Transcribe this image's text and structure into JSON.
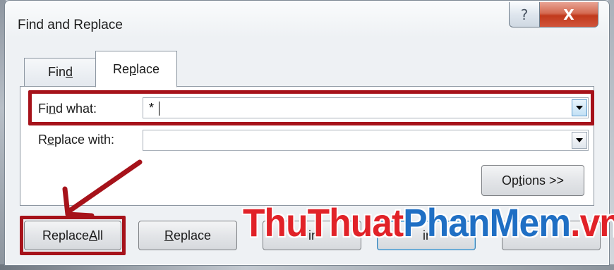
{
  "window": {
    "title": "Find and Replace",
    "help_glyph": "?",
    "close_glyph": "X"
  },
  "tabs": [
    {
      "label_pre": "Fin",
      "label_mnemonic": "d",
      "label_post": ""
    },
    {
      "label_pre": "Re",
      "label_mnemonic": "p",
      "label_post": "lace",
      "active": true
    }
  ],
  "find": {
    "label_pre": "Fi",
    "label_mnemonic": "n",
    "label_post": "d what:",
    "value": "*"
  },
  "replace": {
    "label_pre": "R",
    "label_mnemonic": "e",
    "label_post": "place with:",
    "value": ""
  },
  "buttons": {
    "options": {
      "pre": "Op",
      "mnemonic": "t",
      "post": "ions >>"
    },
    "replace_all": {
      "pre": "Replace ",
      "mnemonic": "A",
      "post": "ll"
    },
    "replace": {
      "pre": "",
      "mnemonic": "R",
      "post": "eplace"
    },
    "find_all_visible": "ir",
    "find_next_visible": "ir"
  },
  "watermark": {
    "part1": "ThuThuat",
    "part2": "PhanMem",
    "part3": ".vn"
  },
  "colors": {
    "highlight": "#a6121a",
    "watermark_red": "#e12228",
    "watermark_blue": "#1f6fc4"
  }
}
